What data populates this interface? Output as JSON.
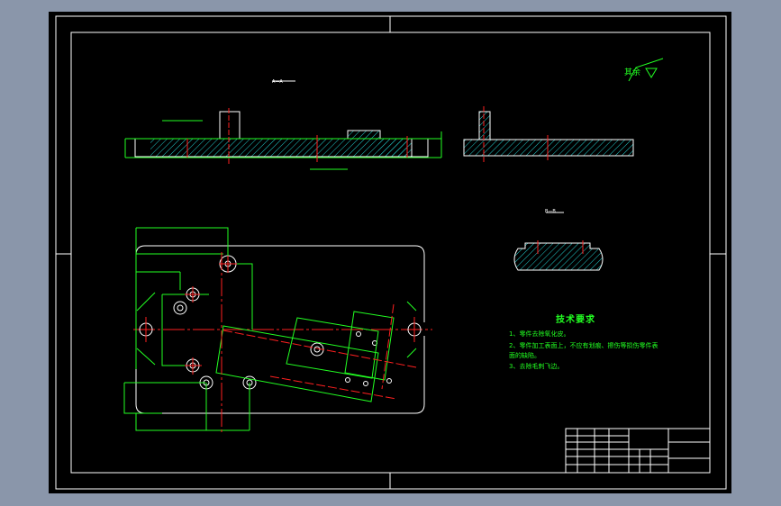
{
  "drawing": {
    "section_labels": [
      "A—A",
      "B—B"
    ],
    "roughness_note": "其余",
    "colors": {
      "background": "#000000",
      "outline": "#ffffff",
      "dimension": "#22ff22",
      "centerline": "#ff2020",
      "hatch": "#22cccc",
      "viewer_bg": "#8a96aa"
    }
  },
  "technical_requirements": {
    "title": "技术要求",
    "items": [
      "1、零件去除氧化皮。",
      "2、零件加工表面上，不应有划痕、擦伤等损伤零件表",
      "面的缺陷。",
      "3、去除毛刺飞边。"
    ]
  }
}
